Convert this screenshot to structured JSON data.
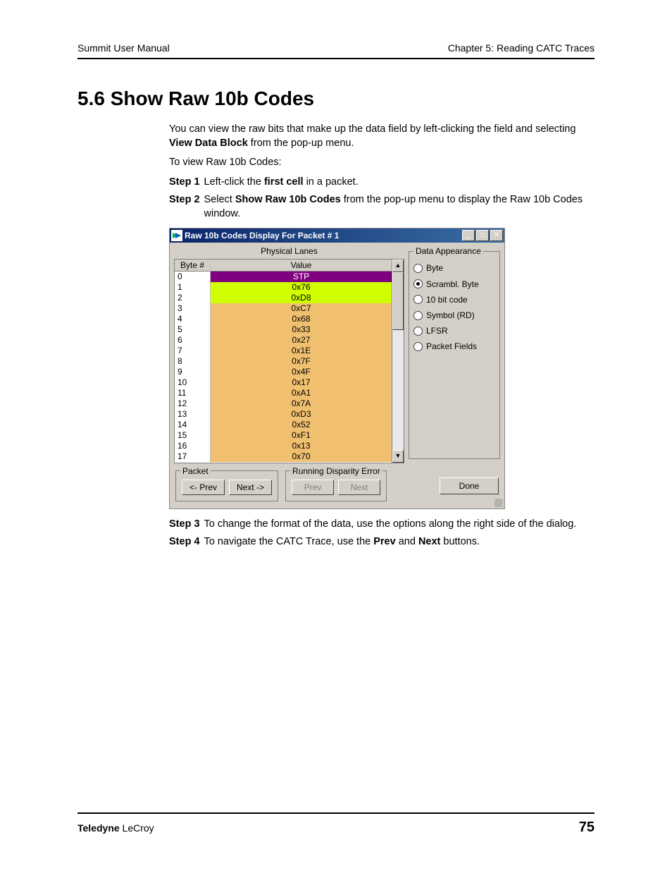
{
  "header": {
    "left": "Summit User Manual",
    "right": "Chapter 5: Reading CATC Traces"
  },
  "section": {
    "heading": "5.6 Show Raw 10b Codes",
    "intro_before_bold": "You can view the raw bits that make up the data field by left-clicking the field and selecting ",
    "intro_bold": "View Data Block",
    "intro_after_bold": " from the pop-up menu.",
    "to_view": "To view Raw 10b Codes:",
    "steps": {
      "s1_label": "Step 1",
      "s1_a": "Left-click the ",
      "s1_b": "first cell",
      "s1_c": " in a packet.",
      "s2_label": "Step 2",
      "s2_a": "Select ",
      "s2_b": "Show Raw 10b Codes",
      "s2_c": " from the pop-up menu to display the Raw 10b Codes window.",
      "s3_label": "Step 3",
      "s3_text": "To change the format of the data, use the options along the right side of the dialog.",
      "s4_label": "Step 4",
      "s4_a": "To navigate the CATC Trace, use the ",
      "s4_b": "Prev",
      "s4_c": " and ",
      "s4_d": "Next",
      "s4_e": " buttons."
    }
  },
  "dialog": {
    "title": "Raw 10b Codes Display For Packet # 1",
    "lanes_caption": "Physical Lanes",
    "byte_header": "Byte #",
    "value_header": "Value",
    "rows": [
      {
        "n": "0",
        "v": "STP",
        "cls": "bg-purple"
      },
      {
        "n": "1",
        "v": "0x76",
        "cls": "bg-yellow"
      },
      {
        "n": "2",
        "v": "0xD8",
        "cls": "bg-yellow"
      },
      {
        "n": "3",
        "v": "0xC7",
        "cls": "bg-orange"
      },
      {
        "n": "4",
        "v": "0x68",
        "cls": "bg-orange"
      },
      {
        "n": "5",
        "v": "0x33",
        "cls": "bg-orange"
      },
      {
        "n": "6",
        "v": "0x27",
        "cls": "bg-orange"
      },
      {
        "n": "7",
        "v": "0x1E",
        "cls": "bg-orange"
      },
      {
        "n": "8",
        "v": "0x7F",
        "cls": "bg-orange"
      },
      {
        "n": "9",
        "v": "0x4F",
        "cls": "bg-orange"
      },
      {
        "n": "10",
        "v": "0x17",
        "cls": "bg-orange"
      },
      {
        "n": "11",
        "v": "0xA1",
        "cls": "bg-orange"
      },
      {
        "n": "12",
        "v": "0x7A",
        "cls": "bg-orange"
      },
      {
        "n": "13",
        "v": "0xD3",
        "cls": "bg-orange"
      },
      {
        "n": "14",
        "v": "0x52",
        "cls": "bg-orange"
      },
      {
        "n": "15",
        "v": "0xF1",
        "cls": "bg-orange"
      },
      {
        "n": "16",
        "v": "0x13",
        "cls": "bg-orange"
      },
      {
        "n": "17",
        "v": "0x70",
        "cls": "bg-orange"
      }
    ],
    "appearance": {
      "title": "Data Appearance",
      "options": [
        "Byte",
        "Scrambl. Byte",
        "10 bit code",
        "Symbol (RD)",
        "LFSR",
        "Packet Fields"
      ],
      "selected_index": 1
    },
    "packet_group": "Packet",
    "packet_prev": "<- Prev",
    "packet_next": "Next ->",
    "rde_group": "Running Disparity Error",
    "rde_prev": "Prev",
    "rde_next": "Next",
    "done": "Done"
  },
  "footer": {
    "left_bold": "Teledyne",
    "left_light": " LeCroy",
    "page": "75"
  }
}
